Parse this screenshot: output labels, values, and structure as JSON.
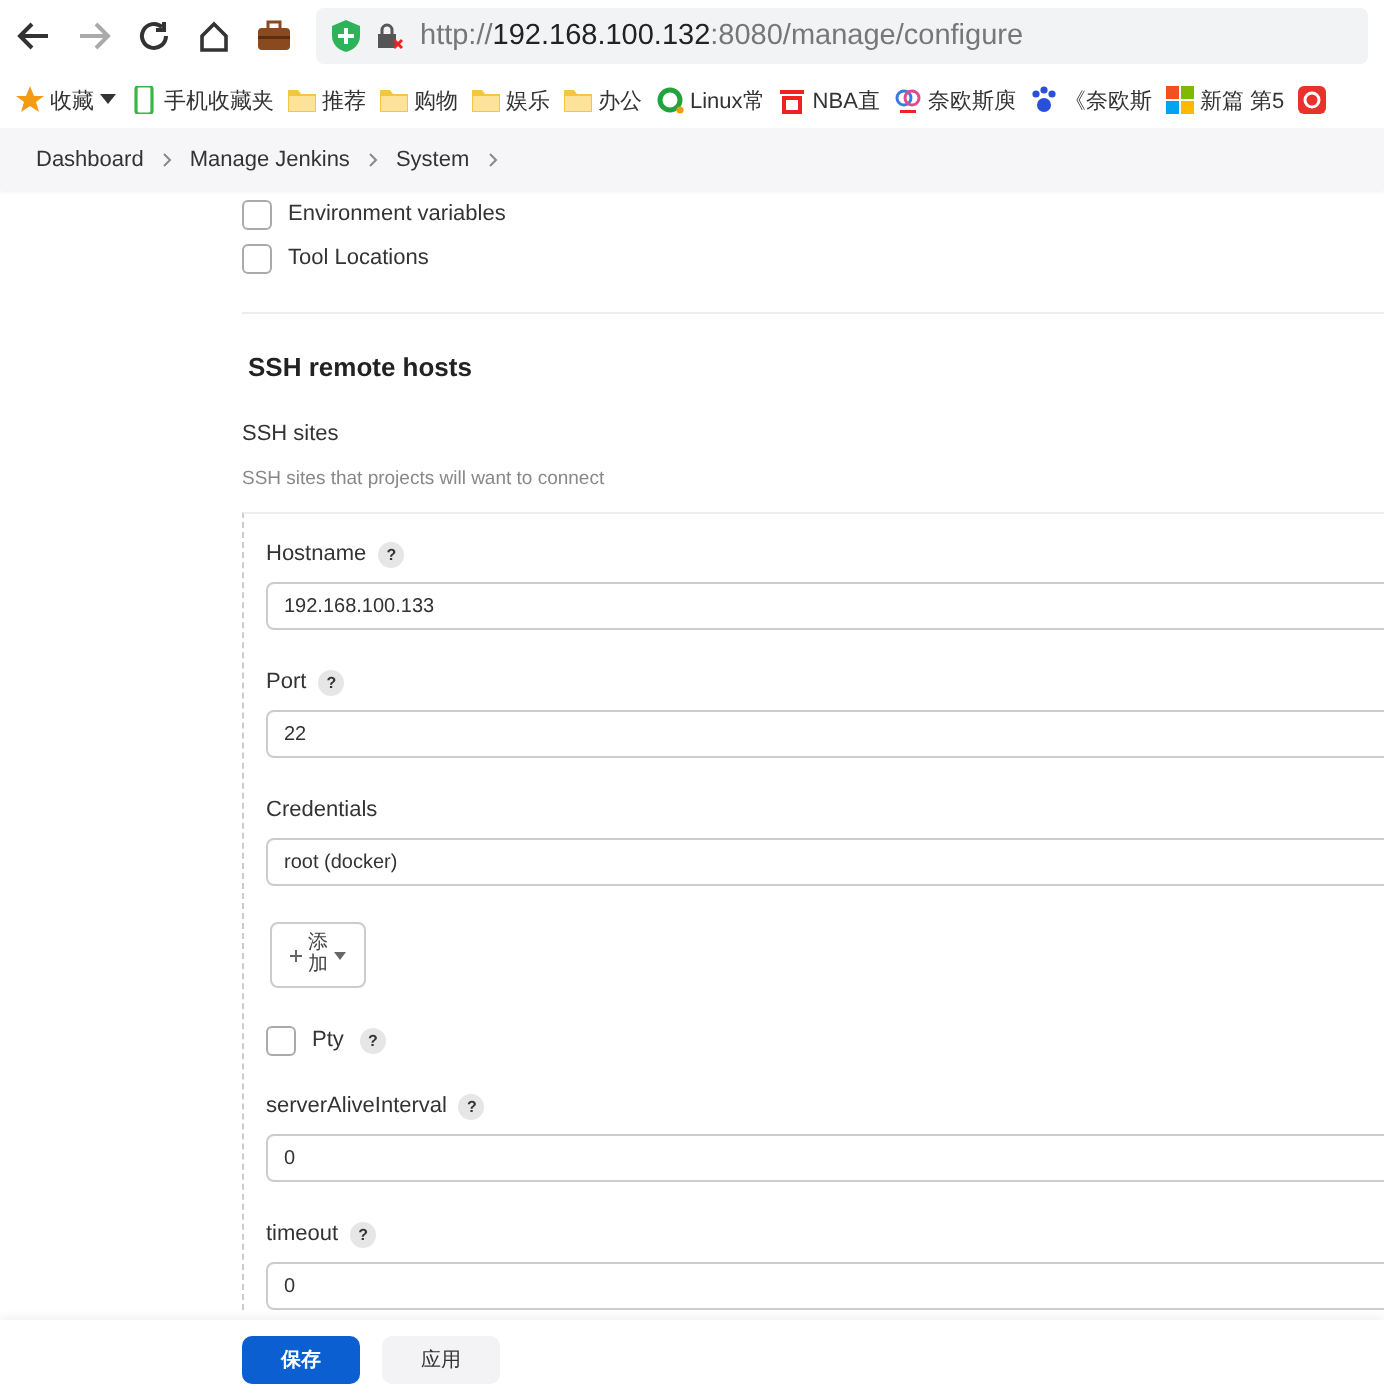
{
  "browser": {
    "url_scheme": "http://",
    "url_host": "192.168.100.132",
    "url_path": ":8080/manage/configure"
  },
  "bookmarks": [
    {
      "kind": "star",
      "label": "收藏"
    },
    {
      "kind": "phone",
      "label": "手机收藏夹"
    },
    {
      "kind": "folder",
      "label": "推荐"
    },
    {
      "kind": "folder",
      "label": "购物"
    },
    {
      "kind": "folder",
      "label": "娱乐"
    },
    {
      "kind": "folder",
      "label": "办公"
    },
    {
      "kind": "ring",
      "label": "Linux常"
    },
    {
      "kind": "red",
      "label": "NBA直"
    },
    {
      "kind": "cloud",
      "label": "奈欧斯庾"
    },
    {
      "kind": "paw",
      "label": "《奈欧斯"
    },
    {
      "kind": "tiles",
      "label": "新篇 第5"
    },
    {
      "kind": "app"
    }
  ],
  "breadcrumbs": [
    "Dashboard",
    "Manage Jenkins",
    "System"
  ],
  "options": [
    {
      "label": "Environment variables",
      "checked": false
    },
    {
      "label": "Tool Locations",
      "checked": false
    }
  ],
  "section": {
    "title": "SSH remote hosts",
    "field_label": "SSH sites",
    "description": "SSH sites that projects will want to connect"
  },
  "host_fields": [
    {
      "kind": "text",
      "label": "Hostname",
      "help": "?",
      "value": "192.168.100.133"
    },
    {
      "kind": "text",
      "label": "Port",
      "help": "?",
      "value": "22"
    },
    {
      "kind": "text",
      "label": "Credentials",
      "value": "root (docker)"
    },
    {
      "kind": "add",
      "label": "添加"
    },
    {
      "kind": "checkbox",
      "label": "Pty",
      "help": "?",
      "checked": false
    },
    {
      "kind": "text",
      "label": "serverAliveInterval",
      "help": "?",
      "value": "0"
    },
    {
      "kind": "text",
      "label": "timeout",
      "help": "?",
      "value": "0"
    }
  ],
  "buttons": [
    {
      "kind": "primary",
      "label": "保存"
    },
    {
      "kind": "secondary",
      "label": "应用"
    }
  ]
}
